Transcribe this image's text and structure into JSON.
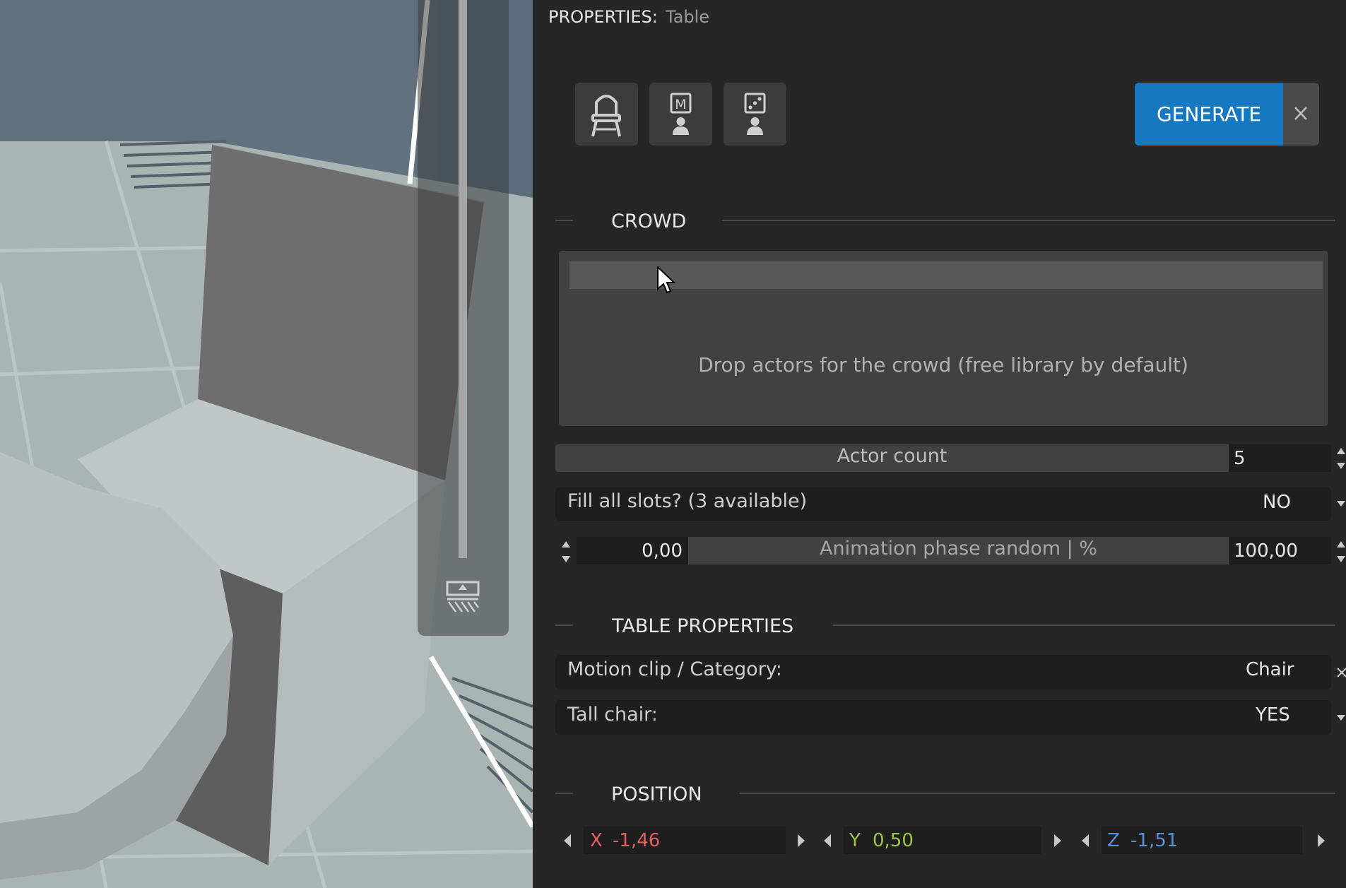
{
  "properties": {
    "label": "PROPERTIES:",
    "value": "Table"
  },
  "toolbar": {
    "buttons": [
      {
        "icon": "chair-icon"
      },
      {
        "icon": "m-actor-icon",
        "letter": "M"
      },
      {
        "icon": "dice-actor-icon"
      }
    ],
    "generate_label": "GENERATE",
    "close_glyph": "×"
  },
  "crowd": {
    "title": "CROWD",
    "drop_text": "Drop actors for the crowd (free library by default)",
    "actor_count_label": "Actor count",
    "actor_count_value": "5",
    "fill_slots_label": "Fill all slots? (3 available)",
    "fill_slots_value": "NO",
    "anim_label": "Animation phase random | %",
    "anim_min": "0,00",
    "anim_max": "100,00"
  },
  "table_properties": {
    "title": "TABLE PROPERTIES",
    "motion_label": "Motion clip / Category:",
    "motion_value": "Chair",
    "tall_label": "Tall chair:",
    "tall_value": "YES",
    "clear_glyph": "×"
  },
  "position": {
    "title": "POSITION",
    "x_label": "X",
    "x_value": "-1,46",
    "y_label": "Y",
    "y_value": "0,50",
    "z_label": "Z",
    "z_value": "-1,51"
  },
  "colors": {
    "accent": "#1778c2",
    "x_axis": "#e06060",
    "y_axis": "#9cc24a",
    "z_axis": "#5b8fd6"
  }
}
